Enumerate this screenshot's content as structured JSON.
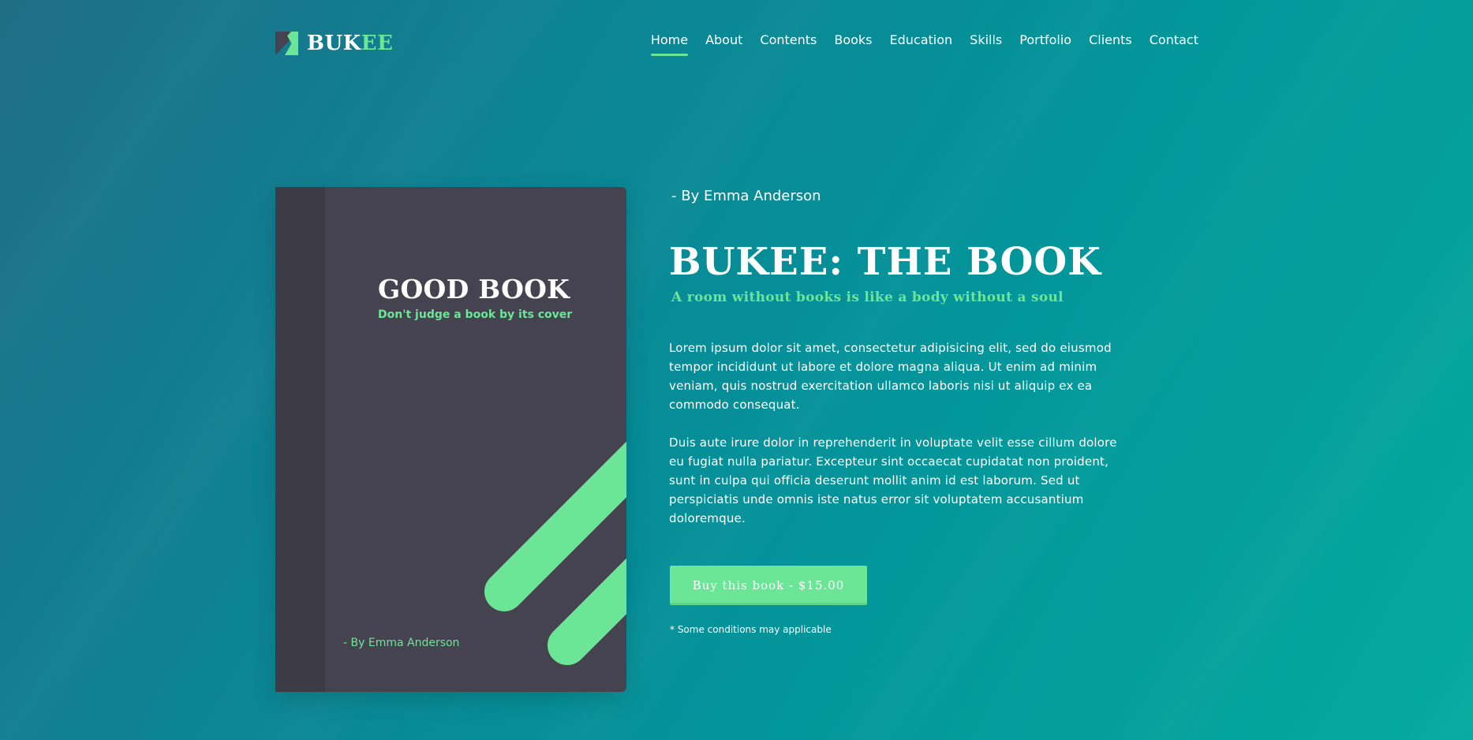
{
  "header": {
    "logo": {
      "part1": "BUK",
      "part2": "EE"
    },
    "nav": [
      {
        "label": "Home",
        "active": true
      },
      {
        "label": "About"
      },
      {
        "label": "Contents"
      },
      {
        "label": "Books"
      },
      {
        "label": "Education"
      },
      {
        "label": "Skills"
      },
      {
        "label": "Portfolio"
      },
      {
        "label": "Clients"
      },
      {
        "label": "Contact"
      }
    ]
  },
  "book_cover": {
    "title": "GOOD BOOK",
    "tagline": "Don't judge a book by its cover",
    "author": "- By Emma Anderson"
  },
  "hero": {
    "byline": "- By Emma Anderson",
    "title": "BUKEE: THE BOOK",
    "subtitle": "A room without books is like a body without a soul",
    "paragraphs": [
      "Lorem ipsum dolor sit amet, consectetur adipisicing elit, sed do eiusmod tempor incididunt ut labore et dolore magna aliqua. Ut enim ad minim veniam, quis nostrud exercitation ullamco laboris nisi ut aliquip ex ea commodo consequat.",
      "Duis aute irure dolor in reprehenderit in voluptate velit esse cillum dolore eu fugiat nulla pariatur. Excepteur sint occaecat cupidatat non proident, sunt in culpa qui officia deserunt mollit anim id est laborum. Sed ut perspiciatis unde omnis iste natus error sit voluptatem accusantium doloremque."
    ],
    "buy_button": "Buy this book - $15.00",
    "note": "* Some conditions may applicable"
  },
  "colors": {
    "accent": "#6be596",
    "book_cover": "#45434f",
    "book_spine": "#3d3b46",
    "bg_start": "#1f6e86",
    "bg_end": "#05aa9e"
  },
  "icons": {
    "logo": "bukee-logo-icon"
  }
}
